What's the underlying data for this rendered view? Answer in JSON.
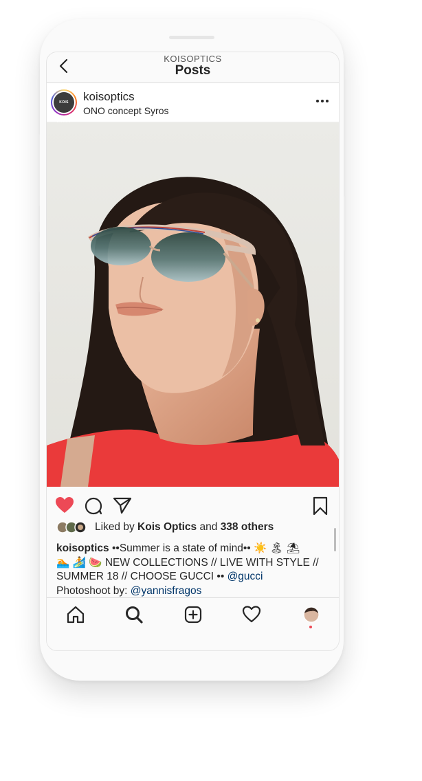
{
  "header": {
    "account": "KOISOPTICS",
    "title": "Posts"
  },
  "post": {
    "username": "koisoptics",
    "location": "ONO concept Syros",
    "avatar_text": "KOIS OPTICS",
    "liked_prefix": "Liked by",
    "liked_by": "Kois Optics",
    "liked_and": "and",
    "liked_others": "338 others",
    "caption_user": "koisoptics",
    "caption_line1": "••Summer is a state of mind•• ☀️ 🏝 ⛱",
    "caption_line2": "🏊 🏄 🍉 NEW COLLECTIONS // LIVE WITH STYLE //",
    "caption_line3": "SUMMER 18 // CHOOSE GUCCI •• ",
    "mention1": "@gucci",
    "caption_line4": "Photoshoot by: ",
    "mention2": "@yannisfragos"
  },
  "colors": {
    "like": "#ed4956",
    "link": "#003569",
    "text": "#262626"
  },
  "icons": {
    "back": "chevron-left-icon",
    "more": "more-horizontal-icon",
    "like": "heart-filled-icon",
    "comment": "comment-bubble-icon",
    "share": "paper-plane-icon",
    "save": "bookmark-icon",
    "home": "home-icon",
    "search": "search-icon",
    "add": "plus-square-icon",
    "activity": "heart-outline-icon",
    "profile": "profile-avatar-icon"
  }
}
